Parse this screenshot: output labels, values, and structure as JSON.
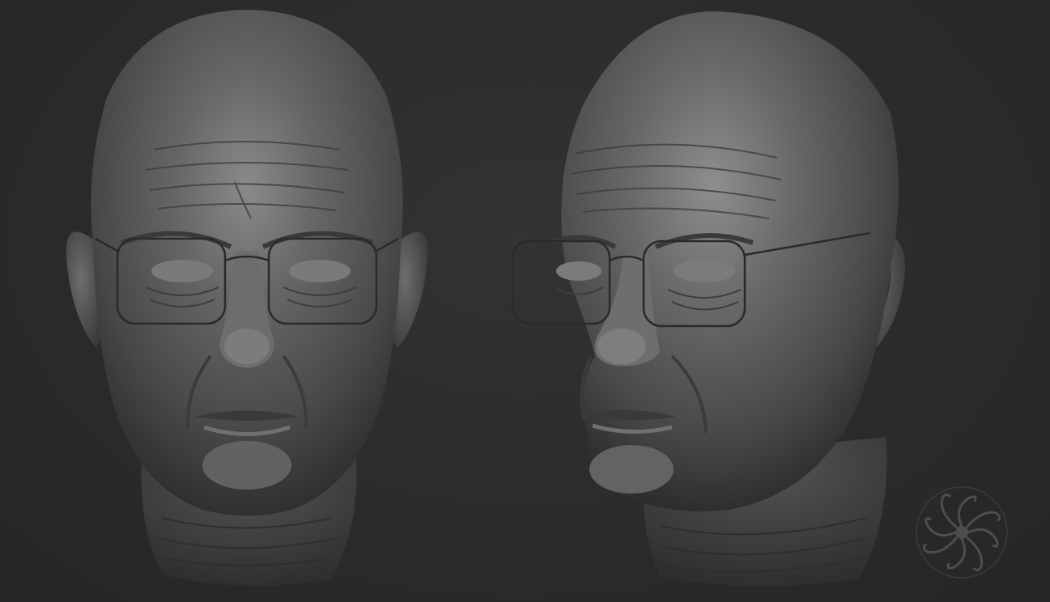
{
  "scene": {
    "background_color": "#2b2b2b",
    "clay_color": "#5a5a5a",
    "highlight_color": "#8c8c8c",
    "shadow_color": "#2a2a2a"
  },
  "views": [
    {
      "name": "front-view",
      "pose": "front"
    },
    {
      "name": "three-quarter-view",
      "pose": "three-quarter"
    }
  ],
  "watermark": {
    "icon": "spiral-tentacle-logo-icon"
  }
}
